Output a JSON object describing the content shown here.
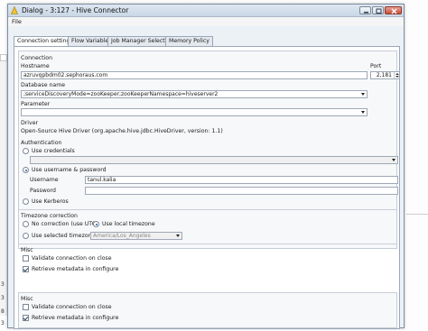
{
  "window": {
    "title": "Dialog - 3:127 - Hive Connector",
    "menu_file": "File"
  },
  "tabs": [
    {
      "label": "Connection settings",
      "active": true
    },
    {
      "label": "Flow Variables",
      "active": false
    },
    {
      "label": "Job Manager Selection",
      "active": false
    },
    {
      "label": "Memory Policy",
      "active": false
    }
  ],
  "connection": {
    "section_label": "Connection",
    "hostname_label": "Hostname",
    "hostname_value": "azruvqpbdm02.sephoraus.com",
    "port_label": "Port",
    "port_value": "2,181",
    "database_label": "Database name",
    "database_value": ";serviceDiscoveryMode=zooKeeper;zooKeeperNamespace=hiveserver2",
    "parameter_label": "Parameter",
    "parameter_value": ""
  },
  "driver": {
    "label": "Driver",
    "value": "Open-Source Hive Driver (org.apache.hive.jdbc.HiveDriver, version: 1.1)"
  },
  "authentication": {
    "label": "Authentication",
    "use_credentials": "Use credentials",
    "use_credentials_selected": false,
    "credentials_value": "",
    "use_username_password": "Use username & password",
    "use_username_password_selected": true,
    "username_label": "Username",
    "username_value": "tanul.kalia",
    "password_label": "Password",
    "password_value": "",
    "use_kerberos": "Use Kerberos",
    "use_kerberos_selected": false
  },
  "timezone": {
    "label": "Timezone correction",
    "no_correction": "No correction (use UTC)",
    "use_local": "Use local timezone",
    "use_selected": "Use selected timezone",
    "selected_value": "America/Los_Angeles",
    "local_selected": true
  },
  "misc1": {
    "label": "Misc",
    "validate_label": "Validate connection on close",
    "validate_checked": false,
    "retrieve_label": "Retrieve metadata in configure",
    "retrieve_checked": true
  },
  "misc2": {
    "label": "Misc",
    "validate_label": "Validate connection on close",
    "validate_checked": false,
    "retrieve_label": "Retrieve metadata in configure",
    "retrieve_checked": true
  },
  "background": {
    "num_a": "3",
    "num_b": "3",
    "num_c": "8",
    "num_d": "3"
  },
  "colors": {
    "titlebar": "#c9d7e6",
    "panel_bg": "#f7f8fa",
    "close_button": "#c9503b",
    "radio_dot": "#2a5fa8"
  },
  "icons": {
    "app": "knime-yellow-triangle-icon",
    "minimize": "minimize-icon",
    "maximize": "maximize-icon",
    "close": "close-icon"
  }
}
